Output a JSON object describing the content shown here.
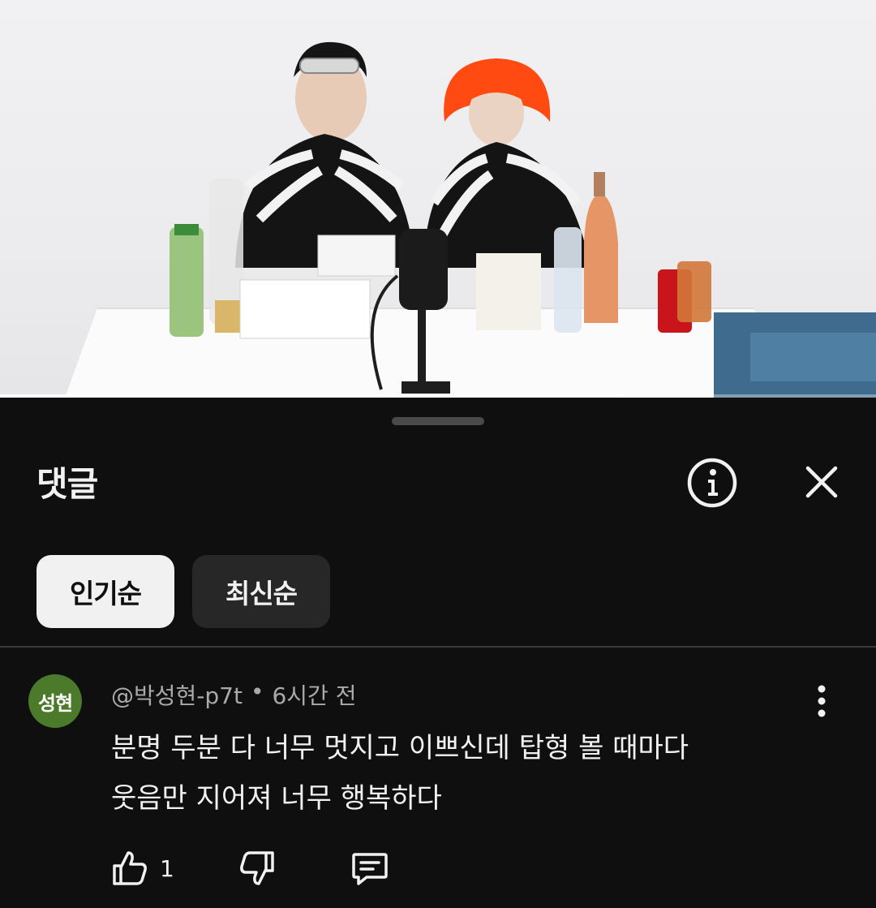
{
  "video": {
    "progress_fraction": 0.71
  },
  "sheet": {
    "title": "댓글",
    "info_icon": "info-icon",
    "close_icon": "close-icon"
  },
  "sort_chips": [
    {
      "label": "인기순",
      "selected": true
    },
    {
      "label": "최신순",
      "selected": false
    }
  ],
  "comments": [
    {
      "avatar_text": "성현",
      "avatar_color": "#4a7a2a",
      "author": "@박성현-p7t",
      "separator": "•",
      "time": "6시간 전",
      "lines": [
        "분명 두분 다 너무 멋지고 이쁘신데 탑형 볼 때마다",
        "웃음만 지어져 너무 행복하다"
      ],
      "like_count": "1",
      "icons": {
        "like": "thumbs-up-icon",
        "dislike": "thumbs-down-icon",
        "reply": "reply-icon",
        "more": "more-vertical-icon"
      }
    }
  ],
  "colors": {
    "background": "#0f0f0f",
    "chip_selected_bg": "#f1f1f1",
    "chip_bg": "#272727",
    "meta_text": "#aaaaaa"
  }
}
